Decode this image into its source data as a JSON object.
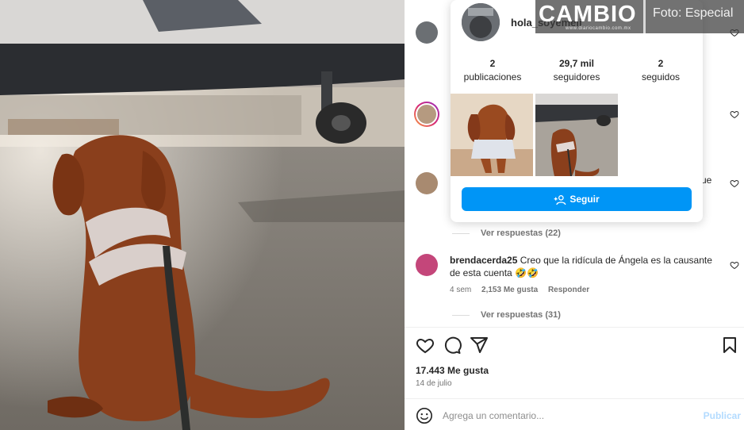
{
  "profile_card": {
    "username": "hola_soyemeli",
    "stats": [
      {
        "value": "2",
        "label": "publicaciones"
      },
      {
        "value": "29,7 mil",
        "label": "seguidores"
      },
      {
        "value": "2",
        "label": "seguidos"
      }
    ],
    "follow_label": "Seguir"
  },
  "comments": {
    "replies_1": "Ver respuestas (22)",
    "partial_text_1": "ue",
    "comment_user": "brendacerda25",
    "comment_text": "Creo que la ridícula de Ángela es la causante de esta cuenta 🤣🤣",
    "comment_age": "4 sem",
    "comment_likes": "2,153 Me gusta",
    "comment_reply": "Responder",
    "replies_2": "Ver respuestas (31)"
  },
  "post": {
    "likes": "17.443 Me gusta",
    "date": "14 de julio"
  },
  "add_comment": {
    "placeholder": "Agrega un comentario...",
    "publish": "Publicar"
  },
  "watermark": {
    "logo": "CAMBIO",
    "site": "www.diariocambio.com.mx",
    "credit": "Foto: Especial"
  },
  "icons": [
    "heart-icon",
    "comment-icon",
    "share-icon",
    "bookmark-icon",
    "emoji-icon",
    "add-person-icon"
  ],
  "colors": {
    "follow_button": "#0095f6",
    "publish": "#b3dbff"
  }
}
